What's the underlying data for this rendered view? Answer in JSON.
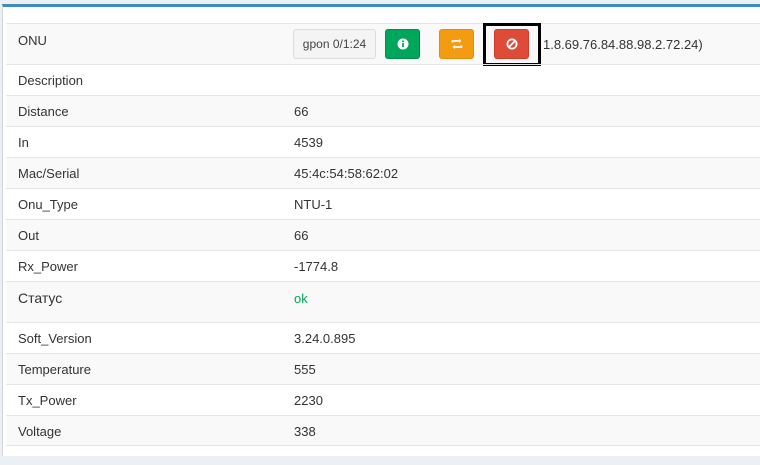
{
  "onu": {
    "label": "ONU",
    "port_button": "gpon 0/1:24",
    "extra_text": "1.8.69.76.84.88.98.2.72.24)",
    "info_icon": "info-circle-icon",
    "reload_icon": "refresh-icon",
    "block_icon": "ban-icon"
  },
  "rows": [
    {
      "label": "Description",
      "value": ""
    },
    {
      "label": "Distance",
      "value": "66"
    },
    {
      "label": "In",
      "value": "4539"
    },
    {
      "label": "Mac/Serial",
      "value": "45:4c:54:58:62:02"
    },
    {
      "label": "Onu_Type",
      "value": "NTU-1"
    },
    {
      "label": "Out",
      "value": "66"
    },
    {
      "label": "Rx_Power",
      "value": "-1774.8"
    },
    {
      "label": "Статус",
      "value": "ok"
    },
    {
      "label": "Soft_Version",
      "value": "3.24.0.895"
    },
    {
      "label": "Temperature",
      "value": "555"
    },
    {
      "label": "Tx_Power",
      "value": "2230"
    },
    {
      "label": "Voltage",
      "value": "338"
    }
  ],
  "colors": {
    "status_ok": "#00a65a",
    "info_button": "#00a65a",
    "reload_button": "#f39c12",
    "block_button": "#dd4b39",
    "accent": "#3c8dbc"
  }
}
